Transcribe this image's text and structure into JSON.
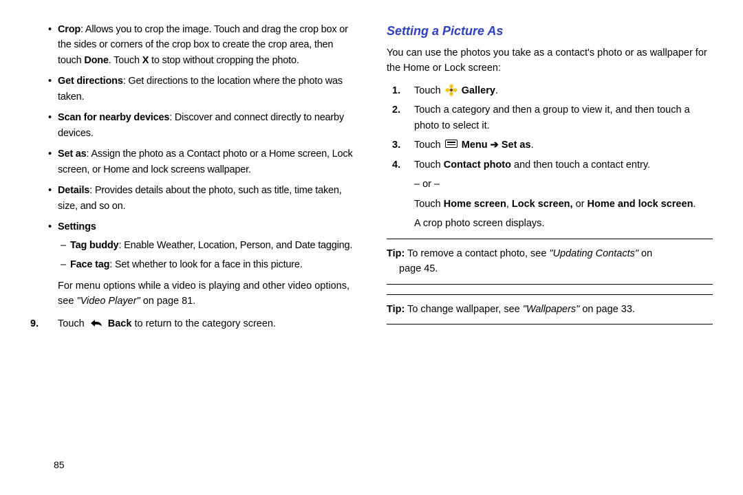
{
  "left": {
    "bullets": {
      "crop": {
        "label": "Crop",
        "t1": ": Allows you to crop the image. Touch and drag the crop box or the sides or corners of the crop box to create the crop area, then touch ",
        "done": "Done",
        "t2": ". Touch ",
        "x": "X",
        "t3": " to stop without cropping the photo."
      },
      "getdir": {
        "label": "Get directions",
        "text": ": Get directions to the location where the photo was taken."
      },
      "scan": {
        "label": "Scan for nearby devices",
        "text": ": Discover and connect directly to nearby devices."
      },
      "setas": {
        "label": "Set as",
        "text": ": Assign the photo as a Contact photo or a Home screen, Lock screen, or Home and lock screens wallpaper."
      },
      "details": {
        "label": "Details",
        "text": ": Provides details about the photo, such as title, time taken, size, and so on."
      },
      "settings": {
        "label": "Settings",
        "sub": {
          "tagbuddy": {
            "label": "Tag buddy",
            "text": ": Enable Weather, Location, Person, and Date tagging."
          },
          "facetag": {
            "label": "Face tag",
            "text": ": Set whether to look for a face in this picture."
          }
        }
      }
    },
    "para": {
      "t1": "For menu options while a video is playing and other video options, see ",
      "ref": "\"Video Player\"",
      "t2": " on page 81."
    },
    "step9": {
      "num": "9.",
      "t1": "Touch ",
      "back": "Back",
      "t2": " to return to the category screen."
    },
    "pagenum": "85"
  },
  "right": {
    "heading": "Setting a Picture As",
    "intro": "You can use the photos you take as a contact's photo or as wallpaper for the Home or Lock screen:",
    "steps": {
      "s1": {
        "num": "1.",
        "t1": "Touch ",
        "gallery": "Gallery",
        "t2": "."
      },
      "s2": {
        "num": "2.",
        "text": "Touch a category and then a group to view it, and then touch a photo to select it."
      },
      "s3": {
        "num": "3.",
        "t1": "Touch ",
        "menu": "Menu",
        "arrow": " ➔ ",
        "setas": "Set as",
        "t2": "."
      },
      "s4": {
        "num": "4.",
        "t1": "Touch ",
        "cp": "Contact photo",
        "t2": " and then touch a contact entry.",
        "or": "– or –",
        "t3": "Touch ",
        "hs": "Home screen",
        "c1": ", ",
        "ls": "Lock screen,",
        "c2": " or ",
        "hls": "Home and lock screen",
        "t4": ".",
        "after": "A crop photo screen displays."
      }
    },
    "tip1": {
      "label": "Tip:",
      "t1": " To remove a contact photo, see ",
      "ref": "\"Updating Contacts\"",
      "t2": " on",
      "line2": "page 45."
    },
    "tip2": {
      "label": "Tip:",
      "t1": " To change wallpaper, see ",
      "ref": "\"Wallpapers\"",
      "t2": " on page 33."
    }
  }
}
